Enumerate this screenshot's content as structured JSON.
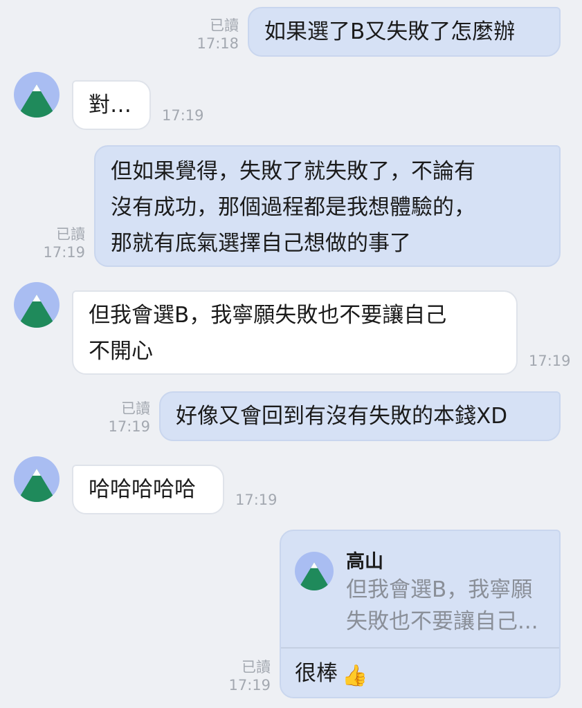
{
  "messages": [
    {
      "dir": "out",
      "text": [
        "如果選了B又失敗了怎麼辦"
      ],
      "read": "已讀",
      "time": "17:18"
    },
    {
      "dir": "in",
      "text": [
        "對…"
      ],
      "time": "17:19"
    },
    {
      "dir": "out",
      "text": [
        "但如果覺得，失敗了就失敗了，不論有",
        "沒有成功，那個過程都是我想體驗的，",
        "那就有底氣選擇自己想做的事了"
      ],
      "read": "已讀",
      "time": "17:19"
    },
    {
      "dir": "in",
      "text": [
        "但我會選B，我寧願失敗也不要讓自己",
        "不開心"
      ],
      "time": "17:19"
    },
    {
      "dir": "out",
      "text": [
        "好像又會回到有沒有失敗的本錢XD"
      ],
      "read": "已讀",
      "time": "17:19"
    },
    {
      "dir": "in",
      "text": [
        "哈哈哈哈哈"
      ],
      "time": "17:19"
    }
  ],
  "reply": {
    "quoted_name": "高山",
    "quoted_text": [
      "但我會選B，我寧願",
      "失敗也不要讓自己..."
    ],
    "text": "很棒",
    "emoji": "👍",
    "read": "已讀",
    "time": "17:19"
  },
  "colors": {
    "background": "#eef0f4",
    "outgoing_bubble": "#d6e1f5",
    "incoming_bubble": "#ffffff",
    "meta_text": "#a3a8b0",
    "avatar_sky": "#a9bdf2",
    "avatar_mountain": "#1f8a5b"
  },
  "icons": {
    "avatar": "mountain-avatar-icon",
    "emoji": "thumbs-up-icon"
  }
}
